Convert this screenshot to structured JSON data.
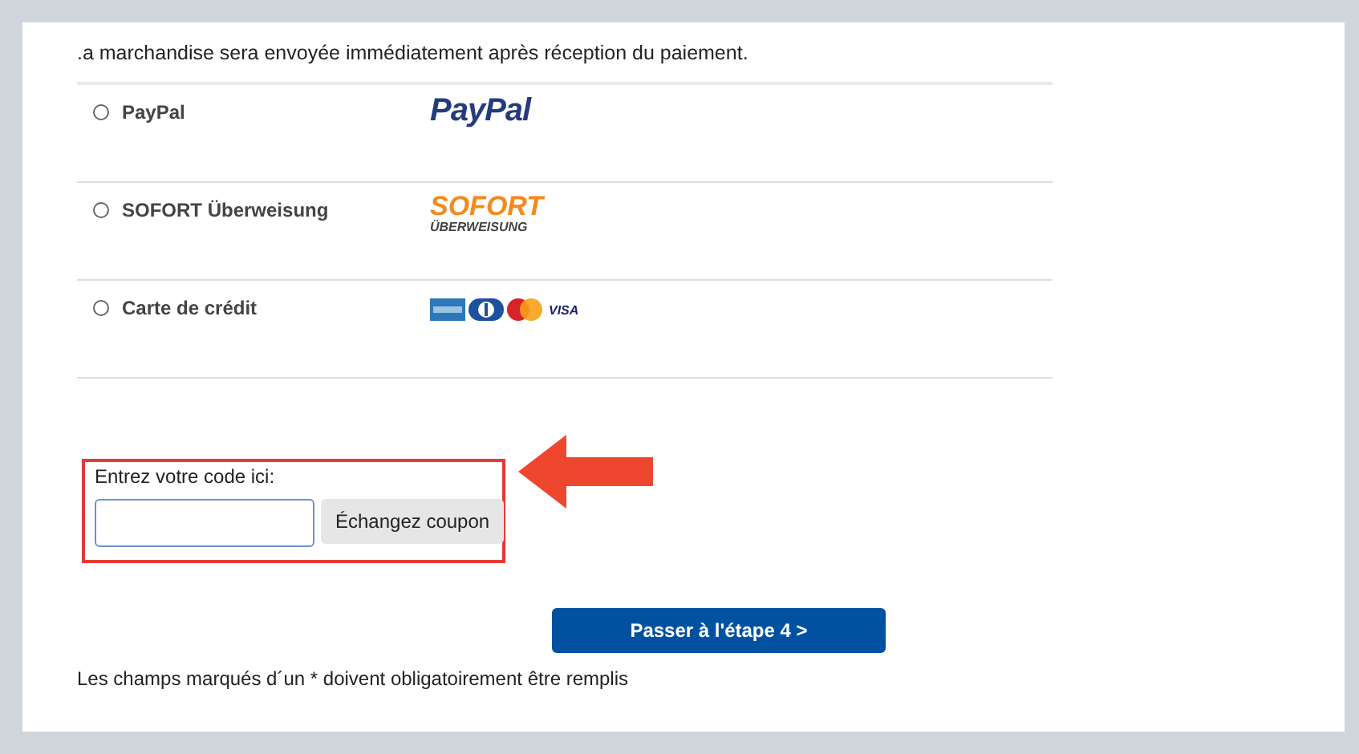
{
  "notice": ".a marchandise sera envoyée immédiatement après réception du paiement.",
  "payment_methods": [
    {
      "label": "PayPal",
      "selected": false,
      "kind": "paypal",
      "logo_text": [
        "PayPal"
      ]
    },
    {
      "label": "SOFORT Überweisung",
      "selected": false,
      "kind": "sofort",
      "logo_text": [
        "SOFORT",
        "ÜBERWEISUNG"
      ]
    },
    {
      "label": "Carte de crédit",
      "selected": false,
      "kind": "cards",
      "logo_text": [
        "VISA"
      ]
    }
  ],
  "coupon": {
    "label": "Entrez votre code ici:",
    "button": "Échangez coupon"
  },
  "next_button": "Passer à l'étape 4 >",
  "footnote": "Les champs marqués d´un * doivent obligatoirement être remplis"
}
